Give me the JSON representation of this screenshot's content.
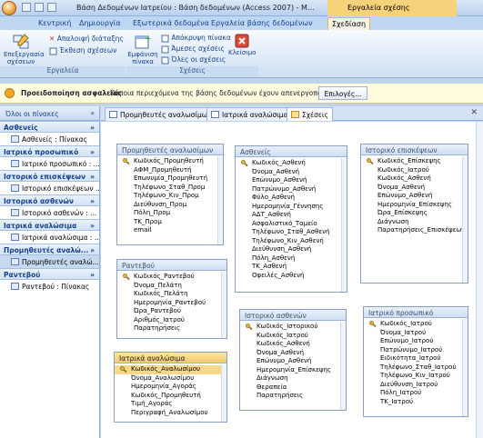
{
  "window": {
    "title": "Βάση Δεδομένων Ιατρείου : Βάση δεδομένων (Access 2007) - M..."
  },
  "context_tab_title": "Εργαλεία σχέσης",
  "ribbon_tabs": [
    "Κεντρική",
    "Δημιουργία",
    "Εξωτερικά δεδομένα",
    "Εργαλεία βάσης δεδομένων",
    "Σχεδίαση"
  ],
  "ribbon": {
    "groups": [
      {
        "label": "Εργαλεία"
      },
      {
        "label": "Σχέσεις"
      }
    ],
    "edit_relationships": "Επεξεργασία σχέσεων",
    "clear_layout": "Απαλοιφή διάταξης",
    "relationship_report": "Έκθεση σχέσεων",
    "show_table": "Εμφάνιση πίνακα",
    "hide_table": "Απόκρυψη πίνακα",
    "direct_relationships": "Άμεσες σχέσεις",
    "all_relationships": "Όλες οι σχέσεις",
    "close": "Κλείσιμο"
  },
  "security": {
    "title": "Προειδοποίηση ασφαλείας",
    "message": "Κάποια περιεχόμενα της βάσης δεδομένων έχουν απενεργοποιηθεί",
    "options_button": "Επιλογές..."
  },
  "nav": {
    "header": "Όλοι οι πίνακες",
    "groups": [
      {
        "label": "Ασθενείς",
        "item": "Ασθενείς : Πίνακας"
      },
      {
        "label": "Ιατρικό προσωπικό",
        "item": "Ιατρικό προσωπικό : ..."
      },
      {
        "label": "Ιστορικό επισκέψεων",
        "item": "Ιστορικό επισκέψεων ..."
      },
      {
        "label": "Ιστορικό ασθενών",
        "item": "Ιστορικό ασθενών : ..."
      },
      {
        "label": "Ιατρικά αναλώσιμα",
        "item": "Ιατρικά αναλώσιμα : ..."
      },
      {
        "label": "Προμηθευτές αναλώ...",
        "item": "Προμηθευτές αναλώ..."
      },
      {
        "label": "Ραντεβού",
        "item": "Ραντεβού : Πίνακας"
      }
    ]
  },
  "doc_tabs": [
    "Προμηθευτές αναλωσίμων",
    "Ιατρικά αναλώσιμα",
    "Σχέσεις"
  ],
  "tables": [
    {
      "title": "Προμηθευτές αναλωσίμων",
      "fields": [
        "Κωδικός_Προμηθευτή",
        "ΑΦΜ_Προμηθευτή",
        "Επωνυμία_Προμηθευτή",
        "Τηλέφωνο_Σταθ_Προμ",
        "Τηλέφωνο_Κιν_Προμ",
        "Διεύθυνση_Προμ",
        "Πόλη_Προμ",
        "ΤΚ_Προμ",
        "email"
      ]
    },
    {
      "title": "Ασθενείς",
      "fields": [
        "Κωδικός_Ασθενή",
        "Όνομα_Ασθενή",
        "Επώνυμο_Ασθενή",
        "Πατρώνυμο_Ασθενή",
        "Φύλο_Ασθενή",
        "Ημερομηνία_Γέννησης",
        "ΑΔΤ_Ασθενή",
        "Ασφαλιστικό_Ταμείο",
        "Τηλέφωνο_Σταθ_Ασθενή",
        "Τηλέφωνο_Κιν_Ασθενή",
        "Διεύθυνση_Ασθενή",
        "Πόλη_Ασθενή",
        "ΤΚ_Ασθενή",
        "Οφειλές_Ασθενή"
      ]
    },
    {
      "title": "Ιστορικό επισκέψεων",
      "fields": [
        "Κωδικός_Επίσκεψης",
        "Κωδικός_Ιατρού",
        "Κωδικός_Ασθενή",
        "Όνομα_Ασθενή",
        "Επώνυμο_Ασθενή",
        "Ημερομηνία_Επίσκεψης",
        "Ώρα_Επίσκεψης",
        "Διάγνωση",
        "Παρατηρήσεις_Επισκέψεων"
      ]
    },
    {
      "title": "Ραντεβού",
      "fields": [
        "Κωδικός_Ραντεβού",
        "Όνομα_Πελάτη",
        "Κωδικός_Πελάτη",
        "Ημερομηνία_Ραντεβού",
        "Ώρα_Ραντεβού",
        "Αριθμός_Ιατρού",
        "Παρατηρήσεις"
      ]
    },
    {
      "title": "Ιστορικό ασθενών",
      "fields": [
        "Κωδικός_Ιστορικού",
        "Κωδικός_Ιατρού",
        "Κωδικός_Ασθενή",
        "Όνομα_Ασθενή",
        "Επώνυμο_Ασθενή",
        "Ημερομηνία_Επίσκεψης",
        "Διάγνωση",
        "Θεραπεία",
        "Παρατηρήσεις"
      ]
    },
    {
      "title": "Ιατρικό προσωπικό",
      "fields": [
        "Κωδικός_Ιατρού",
        "Όνομα_Ιατρού",
        "Επώνυμο_Ιατρού",
        "Πατρώνυμο_Ιατρού",
        "Ειδικότητα_Ιατρού",
        "Τηλέφωνο_Σταθ_Ιατρού",
        "Τηλέφωνο_Κιν_Ιατρού",
        "Διεύθυνση_Ιατρού",
        "Πόλη_Ιατρού",
        "ΤΚ_Ιατρού"
      ]
    },
    {
      "title": "Ιατρικά αναλώσιμα",
      "fields": [
        "Κωδικός_Αναλωσίμου",
        "Όνομα_Αναλωσίμου",
        "Ημερομηνία_Αγοράς",
        "Κωδικός_Προμηθευτή",
        "Τιμή_Αγοράς",
        "Περιγραφή_Αναλωσίμου"
      ]
    }
  ]
}
